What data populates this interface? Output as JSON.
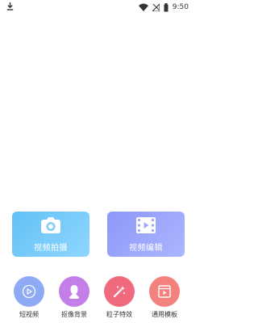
{
  "status": {
    "time": "9:50",
    "left_icon": "download-icon",
    "icons": [
      "wifi-icon",
      "cell-signal-icon",
      "battery-icon"
    ]
  },
  "cards": [
    {
      "label": "视频拍摄",
      "icon": "camera-icon",
      "color": "#6cc6f8"
    },
    {
      "label": "视频编辑",
      "icon": "film-icon",
      "color": "#9aa3fb"
    }
  ],
  "tools": [
    {
      "label": "短视频",
      "icon": "short-video-icon",
      "color": "#8eaaf5"
    },
    {
      "label": "抠像背景",
      "icon": "portrait-icon",
      "color": "#c47ee8"
    },
    {
      "label": "粒子特效",
      "icon": "magic-wand-icon",
      "color": "#f06a7e"
    },
    {
      "label": "通用模板",
      "icon": "template-icon",
      "color": "#f3817d"
    }
  ]
}
